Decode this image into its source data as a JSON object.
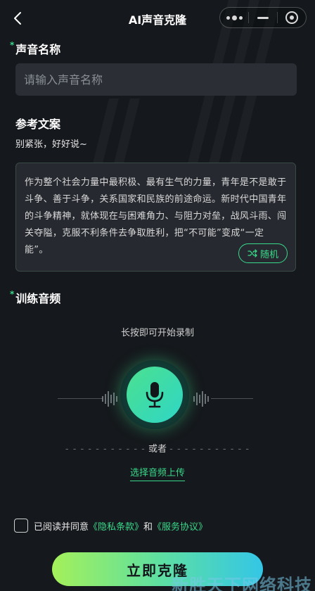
{
  "header": {
    "title": "AI声音克隆",
    "back_icon": "chevron-left-icon"
  },
  "capsule": {
    "icons": [
      "more-dots-icon",
      "minimize-icon",
      "close-target-icon"
    ]
  },
  "voice_name": {
    "label": "声音名称",
    "required_mark": "*",
    "placeholder": "请输入声音名称",
    "value": ""
  },
  "reference": {
    "title": "参考文案",
    "subtitle": "别紧张，好好说~",
    "text": "作为整个社会力量中最积极、最有生气的力量，青年是不是敢于斗争、善于斗争，关系国家和民族的前途命运。新时代中国青年的斗争精神，就体现在与困难角力、与阻力对垒，战风斗雨、闯关夺隘，克服不利条件去争取胜利，把“不可能”变成“一定能”。",
    "random_label": "随机"
  },
  "training": {
    "label": "训练音频",
    "required_mark": "*",
    "hint": "长按即可开始录制",
    "or_label": "或者",
    "upload_label": "选择音频上传"
  },
  "agreement": {
    "prefix": "已阅读并同意",
    "privacy": "《隐私条款》",
    "and": "和",
    "service": "《服务协议》",
    "checked": false
  },
  "submit": {
    "label": "立即克隆"
  },
  "watermark": "新胜天下网络科技",
  "colors": {
    "accent": "#39d98a",
    "background": "#15181c",
    "input_bg": "#2b2f35"
  }
}
